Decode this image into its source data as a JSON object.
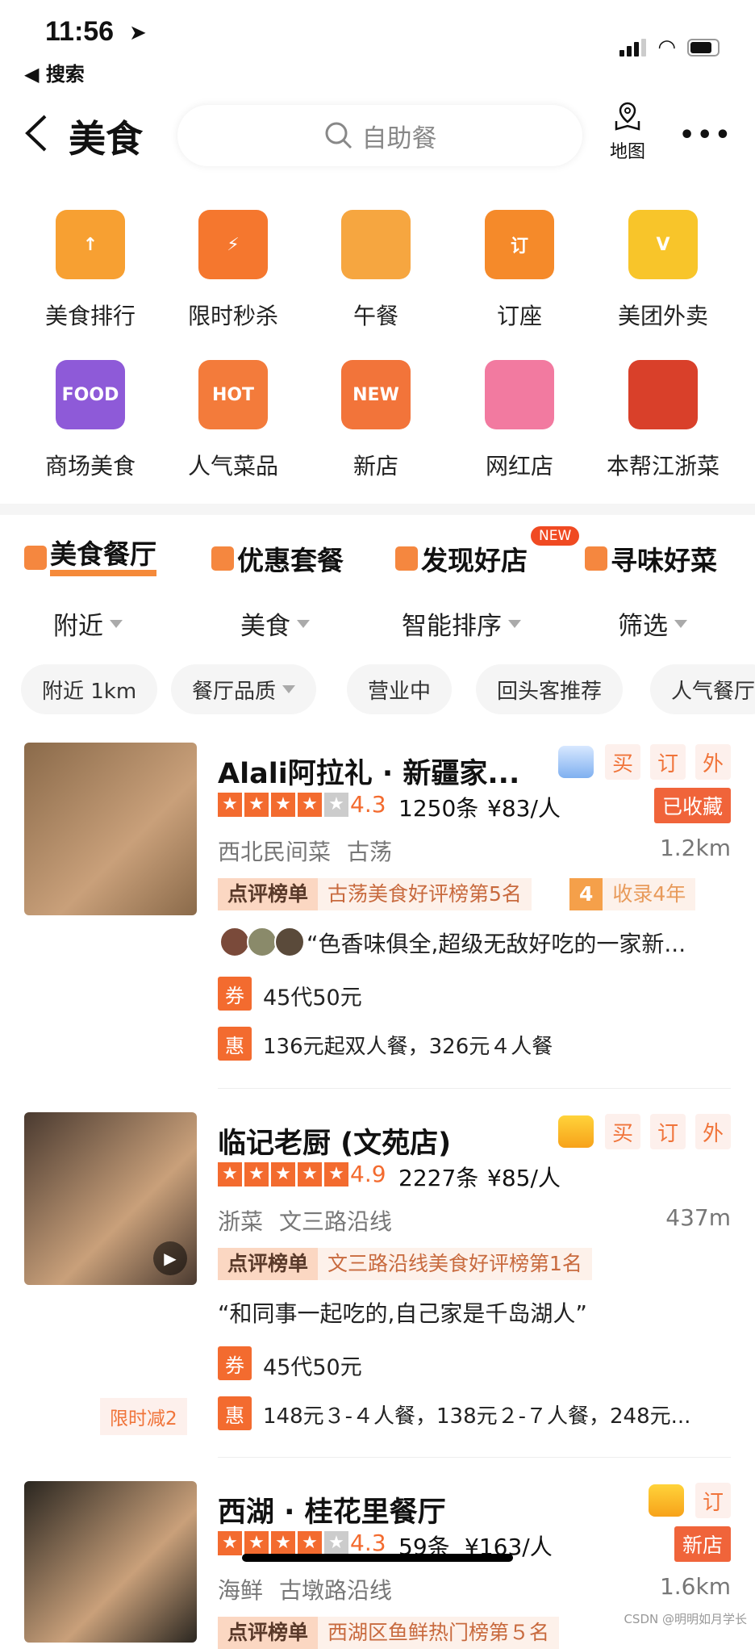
{
  "status": {
    "time": "11:56",
    "back_app": "搜索"
  },
  "nav": {
    "title": "美食",
    "search_placeholder": "自助餐",
    "map_label": "地图",
    "more": "•••"
  },
  "categories": [
    {
      "label": "美食排行",
      "icon": "ranking-icon",
      "glyph": "↑",
      "color": "#f7a032"
    },
    {
      "label": "限时秒杀",
      "icon": "flash-sale-icon",
      "glyph": "⚡",
      "color": "#f5772e"
    },
    {
      "label": "午餐",
      "icon": "lunch-bowl-icon",
      "glyph": "",
      "color": "#f6a640"
    },
    {
      "label": "订座",
      "icon": "reservation-table-icon",
      "glyph": "订",
      "color": "#f58a2a"
    },
    {
      "label": "美团外卖",
      "icon": "meituan-delivery-icon",
      "glyph": "V",
      "color": "#f8c52a"
    },
    {
      "label": "商场美食",
      "icon": "mall-food-icon",
      "glyph": "FOOD",
      "color": "#8e5ad8"
    },
    {
      "label": "人气菜品",
      "icon": "hot-dish-icon",
      "glyph": "HOT",
      "color": "#f37b3b"
    },
    {
      "label": "新店",
      "icon": "new-store-icon",
      "glyph": "NEW",
      "color": "#f2743a"
    },
    {
      "label": "网红店",
      "icon": "influencer-store-icon",
      "glyph": "",
      "color": "#f27aa0"
    },
    {
      "label": "本帮江浙菜",
      "icon": "jiangzhe-cuisine-icon",
      "glyph": "",
      "color": "#d9402a"
    }
  ],
  "tabs": [
    {
      "label": "美食餐厅",
      "active": true
    },
    {
      "label": "优惠套餐"
    },
    {
      "label": "发现好店",
      "badge": "NEW"
    },
    {
      "label": "寻味好菜"
    }
  ],
  "filters": [
    "附近",
    "美食",
    "智能排序",
    "筛选"
  ],
  "chips": [
    {
      "label": "附近 1km"
    },
    {
      "label": "餐厅品质",
      "dropdown": true
    },
    {
      "label": "营业中"
    },
    {
      "label": "回头客推荐"
    },
    {
      "label": "人气餐厅"
    }
  ],
  "restaurants": [
    {
      "name": "Alali阿拉礼 · 新疆家...",
      "crown": "diamond",
      "tags": [
        "买",
        "订",
        "外"
      ],
      "stars": 4,
      "score": "4.3",
      "reviews": "1250条",
      "price": "¥83/人",
      "status_badge": "已收藏",
      "cuisine": "西北民间菜",
      "area": "古荡",
      "distance": "1.2km",
      "rank_label": "点评榜单",
      "rank_text": "古荡美食好评榜第5名",
      "years_num": "4",
      "years_text": "收录4年",
      "review": "“色香味俱全,超级无敌好吃的一家新...",
      "coupon_icon": "券",
      "coupon": "45代50元",
      "deal_icon": "惠",
      "deal": "136元起双人餐，326元４人餐",
      "image_color": "#8a6a4a"
    },
    {
      "name": "临记老厨 (文苑店)",
      "crown": "gold",
      "tags": [
        "买",
        "订",
        "外"
      ],
      "stars": 5,
      "score": "4.9",
      "reviews": "2227条",
      "price": "¥85/人",
      "cuisine": "浙菜",
      "area": "文三路沿线",
      "distance": "437m",
      "rank_label": "点评榜单",
      "rank_text": "文三路沿线美食好评榜第1名",
      "review": "“和同事一起吃的,自己家是千岛湖人”",
      "coupon_icon": "券",
      "coupon": "45代50元",
      "deal_icon": "惠",
      "deal": "148元３-４人餐，138元２-７人餐，248元...",
      "promo": "限时减2",
      "image_color": "#4a3a30"
    },
    {
      "name": "西湖 · 桂花里餐厅",
      "crown": "gold",
      "tags": [
        "订"
      ],
      "stars": 4,
      "score": "4.3",
      "reviews": "59条",
      "price": "¥163/人",
      "status_badge": "新店",
      "cuisine": "海鲜",
      "area": "古墩路沿线",
      "distance": "1.6km",
      "rank_label": "点评榜单",
      "rank_text": "西湖区鱼鲜热门榜第５名",
      "image_color": "#2a2620"
    }
  ],
  "watermark": "CSDN @明明如月学长",
  "colors": {
    "accent": "#f36b2f",
    "tag_bg": "#fdf0ec"
  }
}
